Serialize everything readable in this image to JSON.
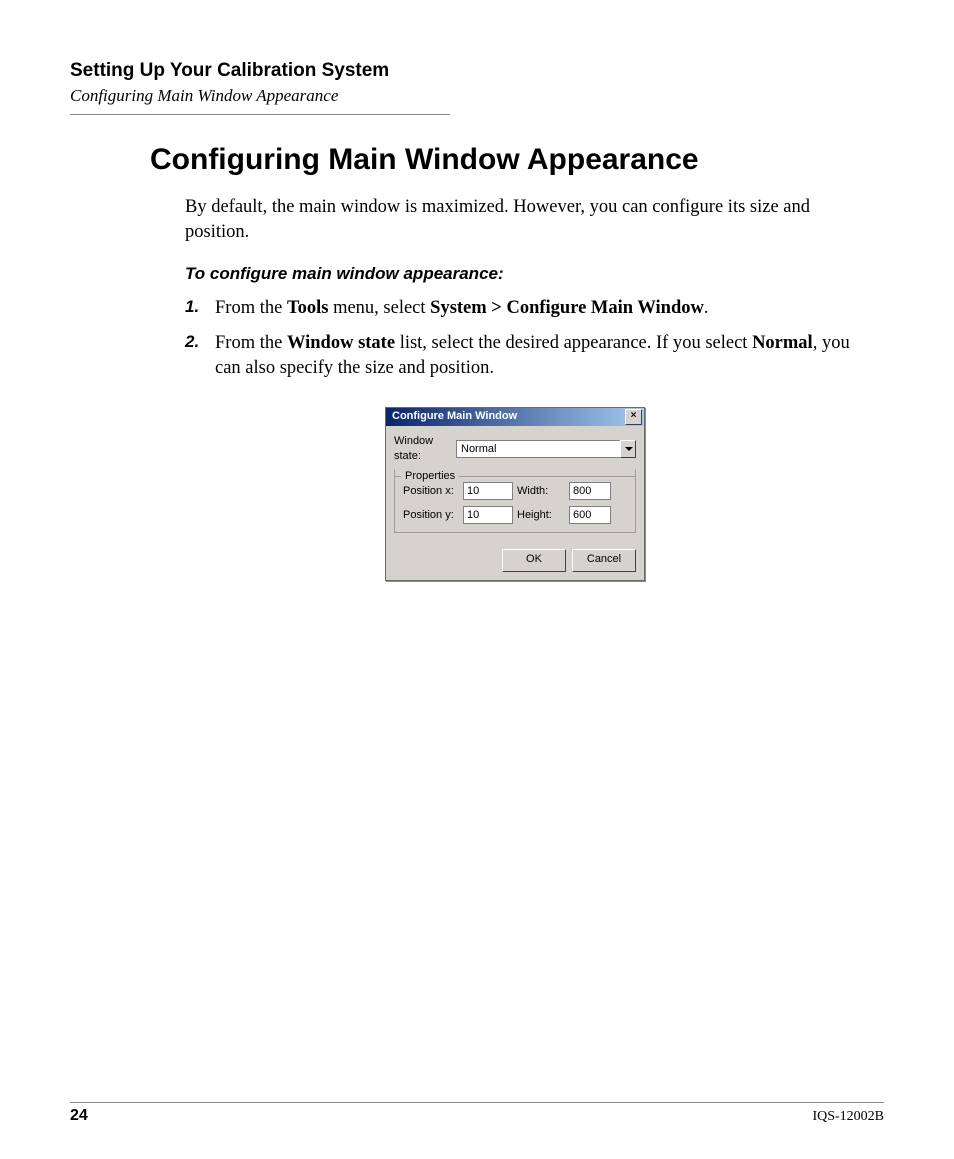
{
  "header": {
    "chapter": "Setting Up Your Calibration System",
    "breadcrumb": "Configuring Main Window Appearance"
  },
  "section": {
    "heading": "Configuring Main Window Appearance",
    "intro": "By default, the main window is maximized. However, you can configure its size and position.",
    "procedure_label": "To configure main window appearance:",
    "steps": {
      "s1": {
        "num": "1.",
        "pre": "From the ",
        "b1": "Tools",
        "mid1": " menu, select ",
        "b2": "System > Configure Main Window",
        "post": "."
      },
      "s2": {
        "num": "2.",
        "pre": "From the ",
        "b1": "Window state",
        "mid1": " list, select the desired appearance. If you select ",
        "b2": "Normal",
        "post": ", you can also specify the size and position."
      }
    }
  },
  "dialog": {
    "title": "Configure Main Window",
    "close": "×",
    "window_state_label": "Window state:",
    "window_state_value": "Normal",
    "properties_legend": "Properties",
    "pos_x_label": "Position x:",
    "pos_x_value": "10",
    "pos_y_label": "Position y:",
    "pos_y_value": "10",
    "width_label": "Width:",
    "width_value": "800",
    "height_label": "Height:",
    "height_value": "600",
    "ok": "OK",
    "cancel": "Cancel"
  },
  "footer": {
    "page": "24",
    "docid": "IQS-12002B"
  }
}
